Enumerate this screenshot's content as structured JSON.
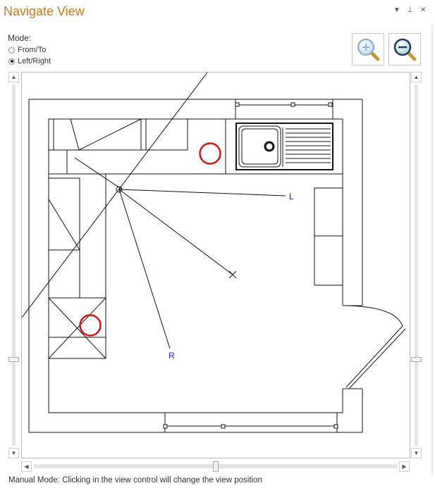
{
  "window": {
    "title": "Navigate View"
  },
  "title_controls": {
    "dropdown": "▼",
    "pin": "⊥",
    "close": "✕"
  },
  "mode": {
    "label": "Mode:",
    "options": [
      {
        "label": "From/To",
        "checked": false
      },
      {
        "label": "Left/Right",
        "checked": true
      }
    ]
  },
  "zoom": {
    "in_icon": "zoom-in-icon",
    "out_icon": "zoom-out-icon"
  },
  "plan": {
    "label_left": "L",
    "label_right": "R"
  },
  "scroll": {
    "up": "▲",
    "down": "▼",
    "left": "◀",
    "right": "▶"
  },
  "status": {
    "text": "Manual Mode: Clicking in the view control will change the view position"
  },
  "colors": {
    "title": "#c87a1e",
    "marker": "#dd1111",
    "label": "#1a1adb"
  }
}
